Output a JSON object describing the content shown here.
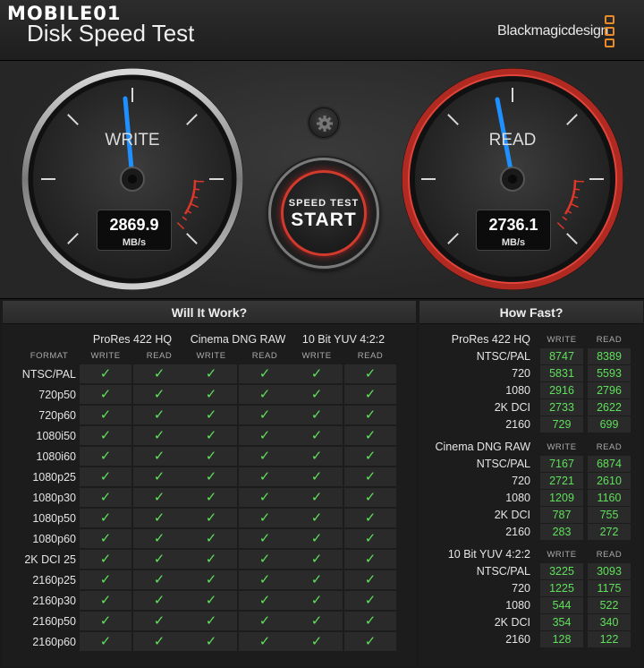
{
  "header": {
    "watermark": "MOBILE01",
    "app_title": "Disk Speed Test",
    "brand": "Blackmagicdesign",
    "accent_color": "#e98a2b"
  },
  "gauges": {
    "write": {
      "label": "WRITE",
      "value": "2869.9",
      "unit": "MB/s"
    },
    "read": {
      "label": "READ",
      "value": "2736.1",
      "unit": "MB/s"
    }
  },
  "start_button": {
    "line1": "SPEED TEST",
    "line2": "START"
  },
  "will_it_work": {
    "title": "Will It Work?",
    "format_header": "FORMAT",
    "write_header": "WRITE",
    "read_header": "READ",
    "codecs": [
      "ProRes 422 HQ",
      "Cinema DNG RAW",
      "10 Bit YUV 4:2:2"
    ],
    "rows": [
      "NTSC/PAL",
      "720p50",
      "720p60",
      "1080i50",
      "1080i60",
      "1080p25",
      "1080p30",
      "1080p50",
      "1080p60",
      "2K DCI 25",
      "2160p25",
      "2160p30",
      "2160p50",
      "2160p60"
    ],
    "check": "✓",
    "check_color": "#5fe05a"
  },
  "how_fast": {
    "title": "How Fast?",
    "write_header": "WRITE",
    "read_header": "READ",
    "sections": [
      {
        "title": "ProRes 422 HQ",
        "rows": [
          {
            "label": "NTSC/PAL",
            "write": "8747",
            "read": "8389"
          },
          {
            "label": "720",
            "write": "5831",
            "read": "5593"
          },
          {
            "label": "1080",
            "write": "2916",
            "read": "2796"
          },
          {
            "label": "2K DCI",
            "write": "2733",
            "read": "2622"
          },
          {
            "label": "2160",
            "write": "729",
            "read": "699"
          }
        ]
      },
      {
        "title": "Cinema DNG RAW",
        "rows": [
          {
            "label": "NTSC/PAL",
            "write": "7167",
            "read": "6874"
          },
          {
            "label": "720",
            "write": "2721",
            "read": "2610"
          },
          {
            "label": "1080",
            "write": "1209",
            "read": "1160"
          },
          {
            "label": "2K DCI",
            "write": "787",
            "read": "755"
          },
          {
            "label": "2160",
            "write": "283",
            "read": "272"
          }
        ]
      },
      {
        "title": "10 Bit YUV 4:2:2",
        "rows": [
          {
            "label": "NTSC/PAL",
            "write": "3225",
            "read": "3093"
          },
          {
            "label": "720",
            "write": "1225",
            "read": "1175"
          },
          {
            "label": "1080",
            "write": "544",
            "read": "522"
          },
          {
            "label": "2K DCI",
            "write": "354",
            "read": "340"
          },
          {
            "label": "2160",
            "write": "128",
            "read": "122"
          }
        ]
      }
    ]
  }
}
